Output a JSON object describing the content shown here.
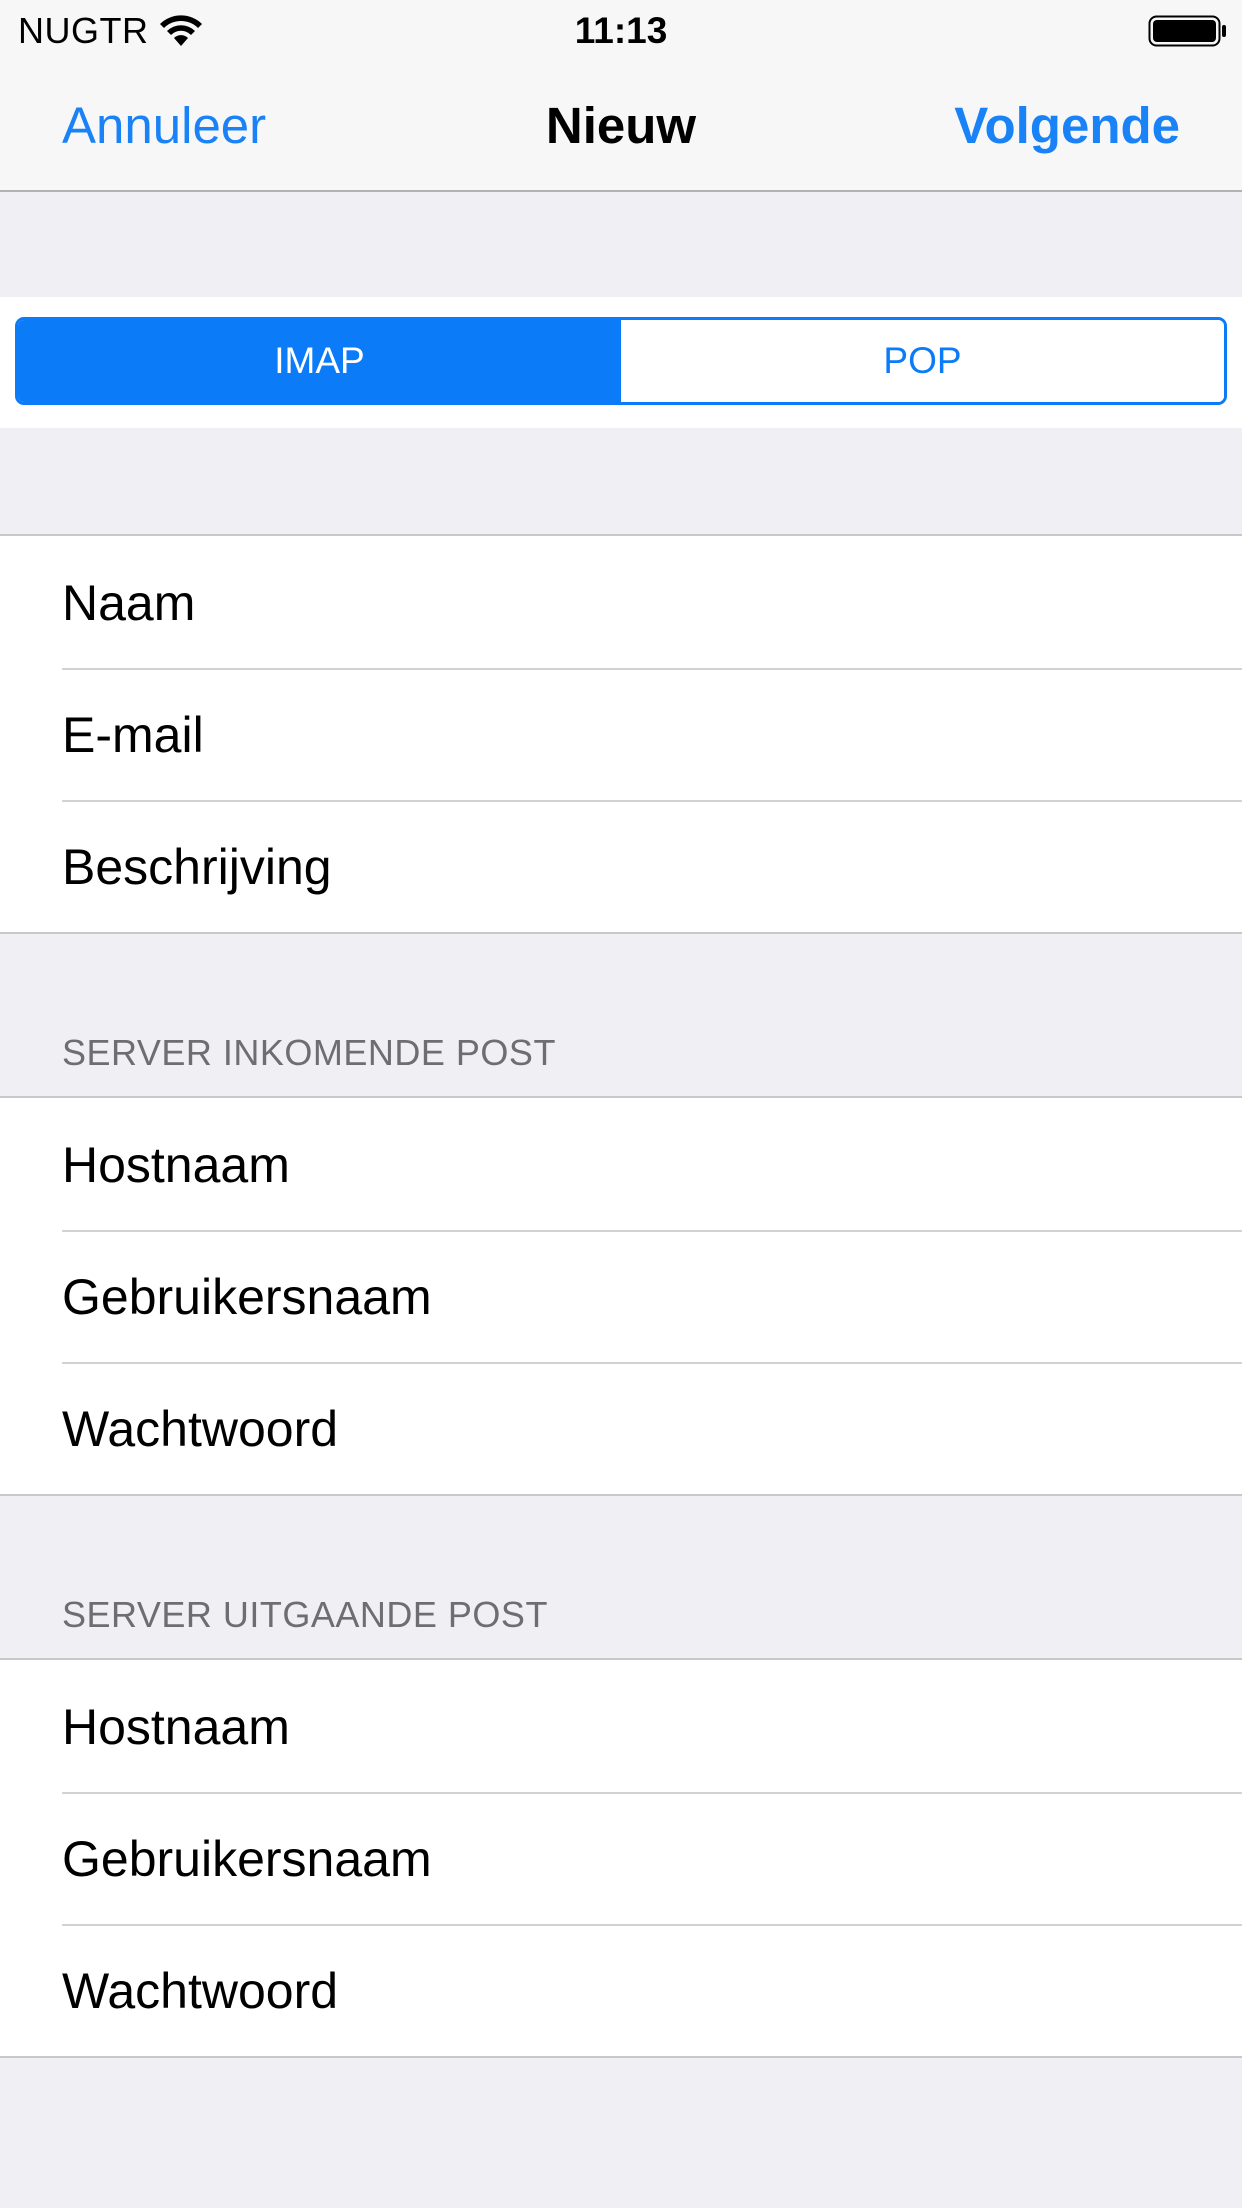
{
  "status_bar": {
    "carrier": "NUGTR",
    "time": "11:13"
  },
  "nav": {
    "cancel": "Annuleer",
    "title": "Nieuw",
    "next": "Volgende"
  },
  "segment": {
    "options": [
      "IMAP",
      "POP"
    ],
    "selected": "IMAP"
  },
  "account": {
    "fields": [
      "Naam",
      "E-mail",
      "Beschrijving"
    ]
  },
  "incoming": {
    "header": "SERVER INKOMENDE POST",
    "fields": [
      "Hostnaam",
      "Gebruikersnaam",
      "Wachtwoord"
    ]
  },
  "outgoing": {
    "header": "SERVER UITGAANDE POST",
    "fields": [
      "Hostnaam",
      "Gebruikersnaam",
      "Wachtwoord"
    ]
  },
  "colors": {
    "accent": "#0b7bf8",
    "link": "#1a82f7",
    "background": "#efeff4"
  }
}
